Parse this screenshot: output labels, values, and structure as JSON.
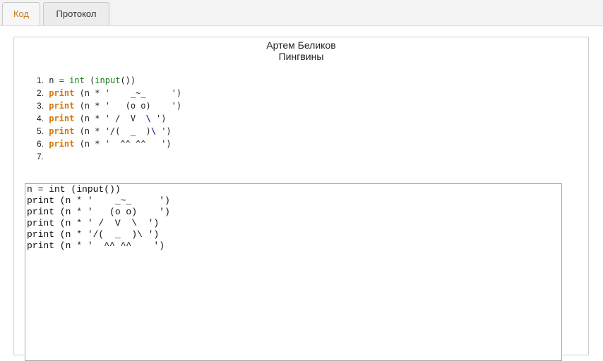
{
  "tabs": [
    {
      "label": "Код",
      "active": true
    },
    {
      "label": "Протокол",
      "active": false
    }
  ],
  "header": {
    "author": "Артем Беликов",
    "title": "Пингвины"
  },
  "code_lines": [
    {
      "num": "1.",
      "text": "n = int (input())"
    },
    {
      "num": "2.",
      "text": "print (n * '    _~_     ')"
    },
    {
      "num": "3.",
      "text": "print (n * '   (o o)    ')"
    },
    {
      "num": "4.",
      "text": "print (n * ' /  V  \\ ')"
    },
    {
      "num": "5.",
      "text": "print (n * '/(  _  )\\ ')"
    },
    {
      "num": "6.",
      "text": "print (n * '  ^^ ^^   ')"
    },
    {
      "num": "7.",
      "text": ""
    }
  ],
  "output_lines": [
    "n = int (input())",
    "print (n * '    _~_     ')",
    "print (n * '   (o o)    ')",
    "print (n * ' /  V  \\  ')",
    "print (n * '/(  _  )\\ ')",
    "print (n * '  ^^ ^^    ')"
  ],
  "colors": {
    "keyword": "#d4760a",
    "builtin": "#1a7d1a",
    "escape": "#1a2ea0",
    "active_tab_text": "#c77a1f"
  }
}
